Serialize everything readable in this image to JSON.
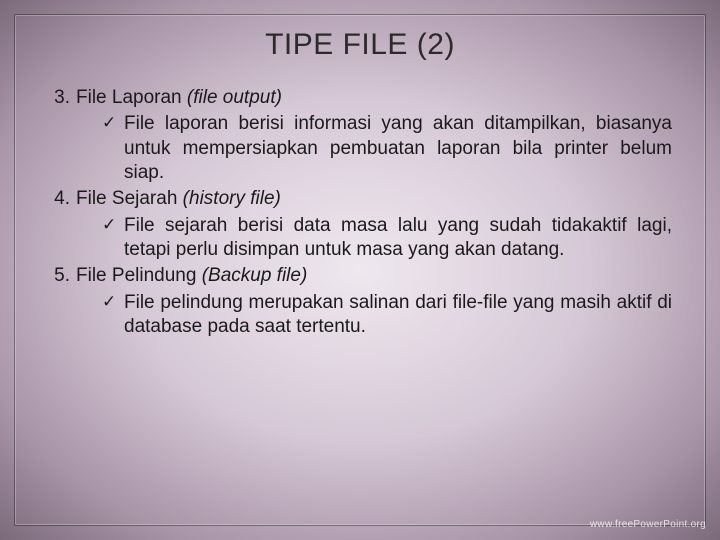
{
  "title": "TIPE FILE (2)",
  "items": [
    {
      "num": "3.",
      "name": "File Laporan",
      "paren": "(file output)",
      "detail": "File laporan berisi informasi yang akan ditampilkan, biasanya untuk mempersiapkan pembuatan laporan bila printer belum siap."
    },
    {
      "num": "4.",
      "name": "File Sejarah",
      "paren": "(history file)",
      "detail": "File sejarah berisi data masa lalu yang sudah tidakaktif lagi, tetapi perlu disimpan untuk masa yang akan datang."
    },
    {
      "num": "5.",
      "name": "File Pelindung",
      "paren": "(Backup file)",
      "detail": "File pelindung merupakan salinan dari file-file yang masih aktif di database pada saat tertentu."
    }
  ],
  "check_glyph": "✓",
  "watermark": "www.freePowerPoint.org"
}
